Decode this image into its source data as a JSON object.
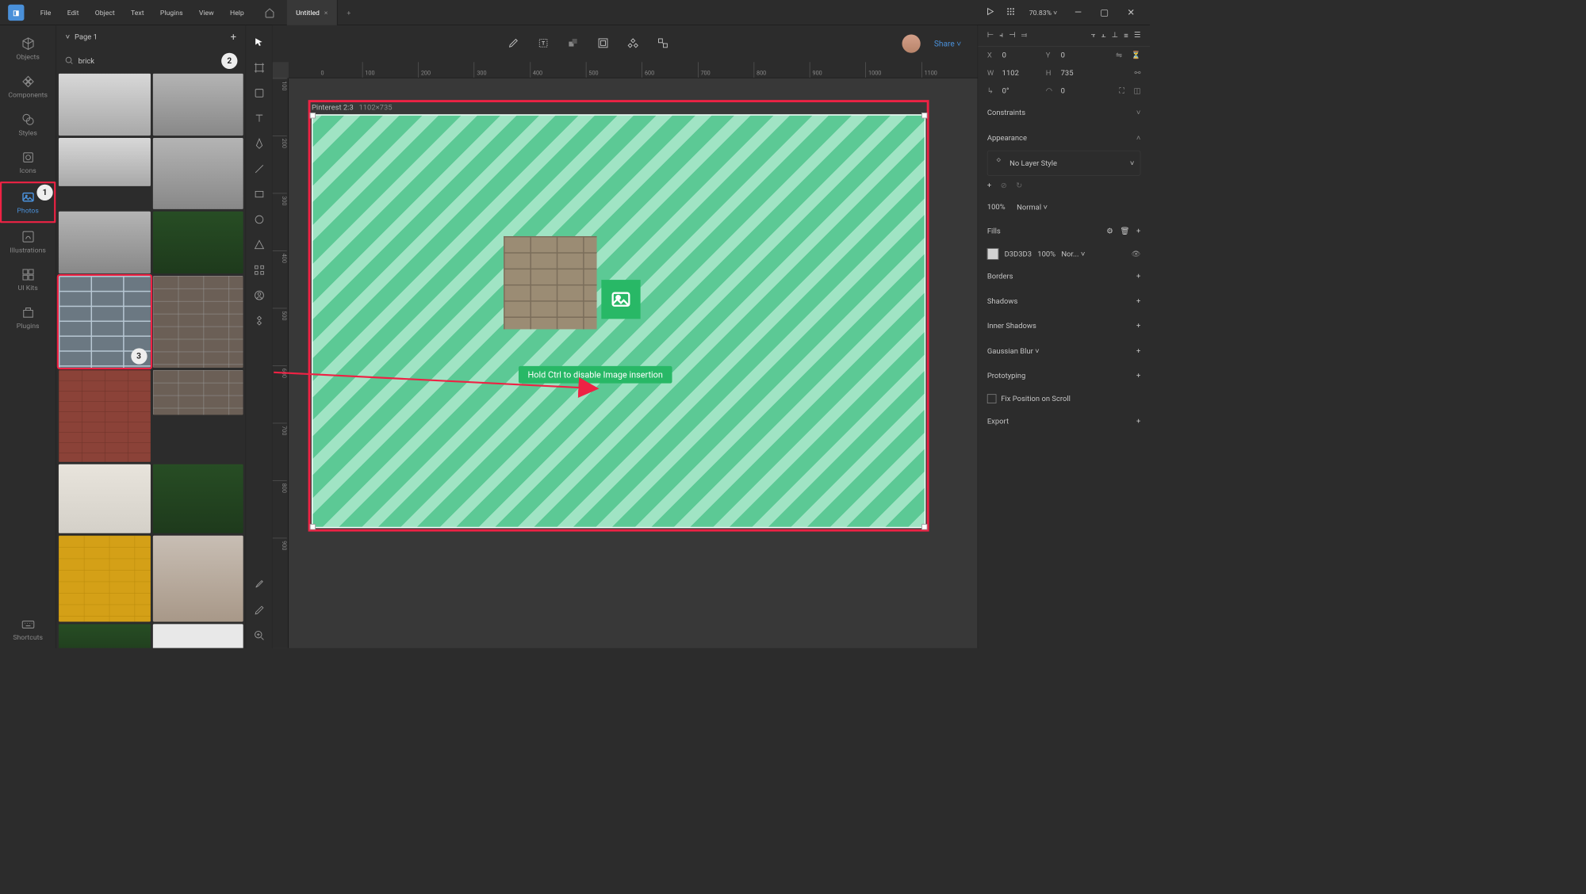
{
  "menu": {
    "items": [
      "File",
      "Edit",
      "Object",
      "Text",
      "Plugins",
      "View",
      "Help"
    ],
    "tab_title": "Untitled",
    "zoom": "70.83%"
  },
  "sidebar": {
    "items": [
      {
        "label": "Objects"
      },
      {
        "label": "Components"
      },
      {
        "label": "Styles"
      },
      {
        "label": "Icons"
      },
      {
        "label": "Photos"
      },
      {
        "label": "Illustrations"
      },
      {
        "label": "UI Kits"
      },
      {
        "label": "Plugins"
      },
      {
        "label": "Shortcuts"
      }
    ]
  },
  "panel": {
    "page_label": "Page 1",
    "search_value": "brick"
  },
  "callouts": {
    "n1": "1",
    "n2": "2",
    "n3": "3"
  },
  "canvas": {
    "artboard_label": "Pinterest 2:3",
    "artboard_dim": "1102×735",
    "hint": "Hold Ctrl to disable Image insertion",
    "ruler_h": [
      "0",
      "100",
      "200",
      "300",
      "400",
      "500",
      "600",
      "700",
      "800",
      "900",
      "1000",
      "1100"
    ],
    "ruler_v": [
      "100",
      "200",
      "300",
      "400",
      "500",
      "600",
      "700",
      "800",
      "900"
    ]
  },
  "header": {
    "share": "Share"
  },
  "inspector": {
    "x_label": "X",
    "x": "0",
    "y_label": "Y",
    "y": "0",
    "w_label": "W",
    "w": "1102",
    "h_label": "H",
    "h": "735",
    "rot": "0°",
    "corner": "0",
    "constraints": "Constraints",
    "appearance": "Appearance",
    "no_layer_style": "No Layer Style",
    "opacity": "100%",
    "blend": "Normal",
    "fills": "Fills",
    "fill_hex": "D3D3D3",
    "fill_pct": "100%",
    "fill_mode": "Nor...",
    "borders": "Borders",
    "shadows": "Shadows",
    "inner_shadows": "Inner Shadows",
    "gaussian": "Gaussian Blur",
    "prototyping": "Prototyping",
    "fix_scroll": "Fix Position on Scroll",
    "export": "Export"
  }
}
